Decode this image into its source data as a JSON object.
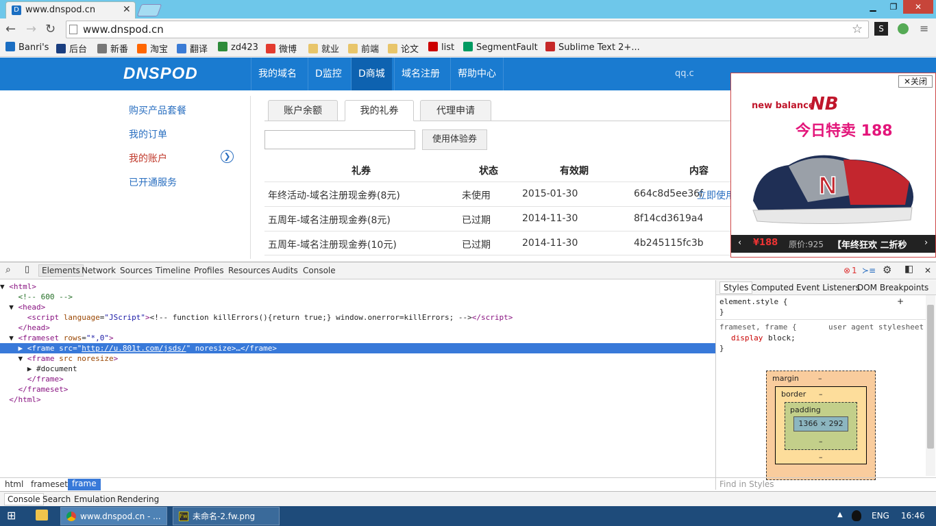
{
  "browser": {
    "tab_title": "www.dnspod.cn",
    "url": "www.dnspod.cn",
    "bookmarks": [
      {
        "label": "Banri's",
        "color": "#1b6ec2"
      },
      {
        "label": "后台",
        "color": "#1a3e80"
      },
      {
        "label": "新番",
        "color": "#777777"
      },
      {
        "label": "淘宝",
        "color": "#ff6600"
      },
      {
        "label": "翻译",
        "color": "#3a7bd5"
      },
      {
        "label": "zd423",
        "color": "#2e8b3a"
      },
      {
        "label": "微博",
        "color": "#e33b2f"
      },
      {
        "label": "就业",
        "color": "#e8c56a"
      },
      {
        "label": "前端",
        "color": "#e8c56a"
      },
      {
        "label": "论文",
        "color": "#e8c56a"
      },
      {
        "label": "list",
        "color": "#cc0000"
      },
      {
        "label": "SegmentFault",
        "color": "#009a61"
      },
      {
        "label": "Sublime Text 2+...",
        "color": "#c62828"
      }
    ]
  },
  "site": {
    "logo": "DNSPOD",
    "nav": [
      "我的域名",
      "D监控",
      "D商城",
      "域名注册",
      "帮助中心"
    ],
    "user_email": "qq.c",
    "sidebar": [
      "购买产品套餐",
      "我的订单",
      "我的账户",
      "已开通服务"
    ],
    "tabs": [
      "账户余额",
      "我的礼券",
      "代理申请"
    ],
    "coupon_placeholder": "",
    "use_button": "使用体验券",
    "table": {
      "headers": [
        "礼券",
        "状态",
        "有效期",
        "内容"
      ],
      "rows": [
        {
          "name": "年终活动-域名注册现金券(8元)",
          "status": "未使用",
          "expiry": "2015-01-30",
          "content": "664c8d5ee36f",
          "action": "立即使用"
        },
        {
          "name": "五周年-域名注册现金券(8元)",
          "status": "已过期",
          "expiry": "2014-11-30",
          "content": "8f14cd3619a4",
          "action": ""
        },
        {
          "name": "五周年-域名注册现金券(10元)",
          "status": "已过期",
          "expiry": "2014-11-30",
          "content": "4b245115fc3b",
          "action": ""
        }
      ]
    }
  },
  "ad": {
    "close": "✕关闭",
    "brand": "new balance",
    "promo": "今日特卖 188",
    "price": "¥188",
    "orig_price": "原价:925",
    "caption": "【年终狂欢 二折秒"
  },
  "devtools": {
    "tabs": [
      "Elements",
      "Network",
      "Sources",
      "Timeline",
      "Profiles",
      "Resources",
      "Audits",
      "Console"
    ],
    "error_count": "1",
    "style_tabs": [
      "Styles",
      "Computed",
      "Event Listeners",
      "DOM Breakpoints"
    ],
    "element_style": "element.style {",
    "rule_selector": "frameset, frame {",
    "rule_source": "user agent stylesheet",
    "rule_prop": "display",
    "rule_val": "block;",
    "box": {
      "margin": "margin",
      "border": "border",
      "padding": "padding",
      "size": "1366 × 292",
      "dash": "–"
    },
    "find_placeholder": "Find in Styles",
    "breadcrumbs": [
      "html",
      "frameset",
      "frame"
    ],
    "drawer_tabs": [
      "Console",
      "Search",
      "Emulation",
      "Rendering"
    ]
  },
  "taskbar": {
    "items": [
      "www.dnspod.cn - ...",
      "未命名-2.fw.png"
    ],
    "lang": "ENG",
    "time": "16:46"
  }
}
